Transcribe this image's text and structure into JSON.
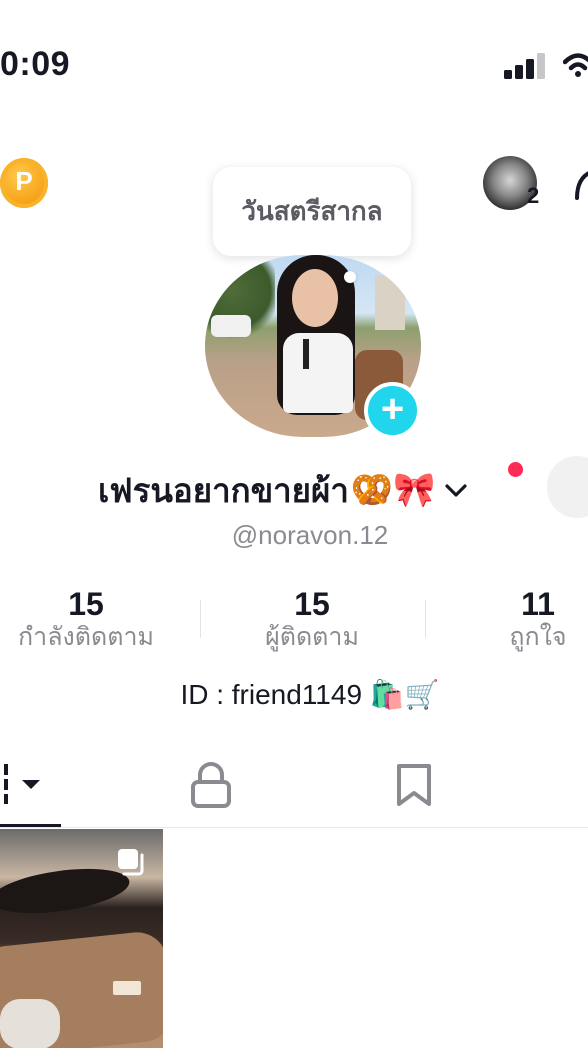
{
  "status_bar": {
    "time": "0:09"
  },
  "header": {
    "coin_letter": "P",
    "friend_count": "2"
  },
  "bubble": {
    "text": "วันสตรีสากล"
  },
  "profile": {
    "display_name": "เฟรนอยากขายผ้า",
    "name_emoji": "🥨🎀",
    "username": "@noravon.12"
  },
  "stats": [
    {
      "value": "15",
      "label": "กำลังติดตาม"
    },
    {
      "value": "15",
      "label": "ผู้ติดตาม"
    },
    {
      "value": "11",
      "label": "ถูกใจ"
    }
  ],
  "bio": {
    "text": "ID : friend1149 🛍️🛒"
  },
  "tabs": [
    {
      "icon": "grid-videos-icon"
    },
    {
      "icon": "lock-icon"
    },
    {
      "icon": "bookmark-icon"
    }
  ],
  "colors": {
    "accent_cyan": "#20d5ec",
    "accent_red": "#fe2c55",
    "coin": "#f7a51c"
  }
}
